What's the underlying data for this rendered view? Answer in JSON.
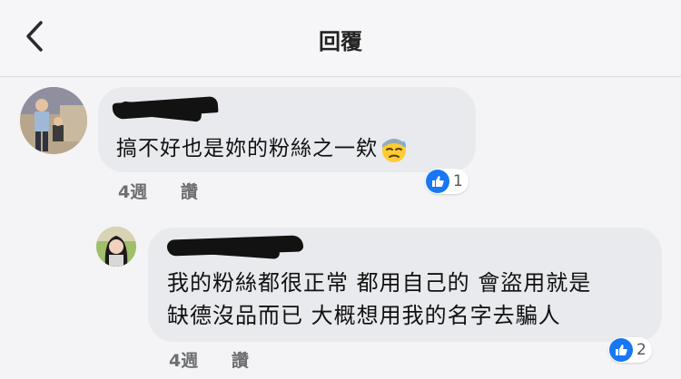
{
  "header": {
    "title": "回覆"
  },
  "comments": [
    {
      "text": "搞不好也是妳的粉絲之一欸",
      "emoji": "downcast-sweat-face-emoji",
      "time": "4週",
      "reply_label": "讚",
      "reaction_count": "1"
    },
    {
      "text_line1": "我的粉絲都很正常 都用自己的 會盜用就是",
      "text_line2": "缺德沒品而已 大概想用我的名字去騙人",
      "time": "4週",
      "reply_label": "讚",
      "reaction_count": "2"
    }
  ],
  "colors": {
    "like_blue": "#1877f2",
    "bubble": "#e9eaee",
    "background": "#f4f4f6"
  }
}
